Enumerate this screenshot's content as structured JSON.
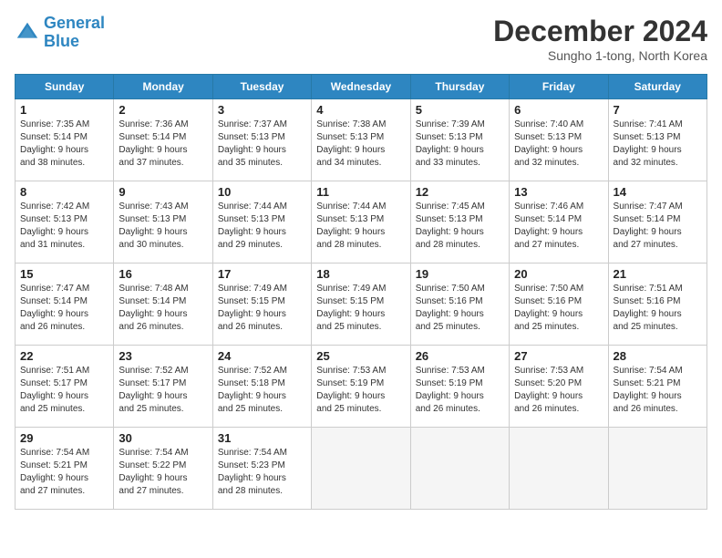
{
  "header": {
    "logo": {
      "line1": "General",
      "line2": "Blue"
    },
    "title": "December 2024",
    "subtitle": "Sungho 1-tong, North Korea"
  },
  "weekdays": [
    "Sunday",
    "Monday",
    "Tuesday",
    "Wednesday",
    "Thursday",
    "Friday",
    "Saturday"
  ],
  "weeks": [
    [
      {
        "day": 1,
        "info": "Sunrise: 7:35 AM\nSunset: 5:14 PM\nDaylight: 9 hours\nand 38 minutes."
      },
      {
        "day": 2,
        "info": "Sunrise: 7:36 AM\nSunset: 5:14 PM\nDaylight: 9 hours\nand 37 minutes."
      },
      {
        "day": 3,
        "info": "Sunrise: 7:37 AM\nSunset: 5:13 PM\nDaylight: 9 hours\nand 35 minutes."
      },
      {
        "day": 4,
        "info": "Sunrise: 7:38 AM\nSunset: 5:13 PM\nDaylight: 9 hours\nand 34 minutes."
      },
      {
        "day": 5,
        "info": "Sunrise: 7:39 AM\nSunset: 5:13 PM\nDaylight: 9 hours\nand 33 minutes."
      },
      {
        "day": 6,
        "info": "Sunrise: 7:40 AM\nSunset: 5:13 PM\nDaylight: 9 hours\nand 32 minutes."
      },
      {
        "day": 7,
        "info": "Sunrise: 7:41 AM\nSunset: 5:13 PM\nDaylight: 9 hours\nand 32 minutes."
      }
    ],
    [
      {
        "day": 8,
        "info": "Sunrise: 7:42 AM\nSunset: 5:13 PM\nDaylight: 9 hours\nand 31 minutes."
      },
      {
        "day": 9,
        "info": "Sunrise: 7:43 AM\nSunset: 5:13 PM\nDaylight: 9 hours\nand 30 minutes."
      },
      {
        "day": 10,
        "info": "Sunrise: 7:44 AM\nSunset: 5:13 PM\nDaylight: 9 hours\nand 29 minutes."
      },
      {
        "day": 11,
        "info": "Sunrise: 7:44 AM\nSunset: 5:13 PM\nDaylight: 9 hours\nand 28 minutes."
      },
      {
        "day": 12,
        "info": "Sunrise: 7:45 AM\nSunset: 5:13 PM\nDaylight: 9 hours\nand 28 minutes."
      },
      {
        "day": 13,
        "info": "Sunrise: 7:46 AM\nSunset: 5:14 PM\nDaylight: 9 hours\nand 27 minutes."
      },
      {
        "day": 14,
        "info": "Sunrise: 7:47 AM\nSunset: 5:14 PM\nDaylight: 9 hours\nand 27 minutes."
      }
    ],
    [
      {
        "day": 15,
        "info": "Sunrise: 7:47 AM\nSunset: 5:14 PM\nDaylight: 9 hours\nand 26 minutes."
      },
      {
        "day": 16,
        "info": "Sunrise: 7:48 AM\nSunset: 5:14 PM\nDaylight: 9 hours\nand 26 minutes."
      },
      {
        "day": 17,
        "info": "Sunrise: 7:49 AM\nSunset: 5:15 PM\nDaylight: 9 hours\nand 26 minutes."
      },
      {
        "day": 18,
        "info": "Sunrise: 7:49 AM\nSunset: 5:15 PM\nDaylight: 9 hours\nand 25 minutes."
      },
      {
        "day": 19,
        "info": "Sunrise: 7:50 AM\nSunset: 5:16 PM\nDaylight: 9 hours\nand 25 minutes."
      },
      {
        "day": 20,
        "info": "Sunrise: 7:50 AM\nSunset: 5:16 PM\nDaylight: 9 hours\nand 25 minutes."
      },
      {
        "day": 21,
        "info": "Sunrise: 7:51 AM\nSunset: 5:16 PM\nDaylight: 9 hours\nand 25 minutes."
      }
    ],
    [
      {
        "day": 22,
        "info": "Sunrise: 7:51 AM\nSunset: 5:17 PM\nDaylight: 9 hours\nand 25 minutes."
      },
      {
        "day": 23,
        "info": "Sunrise: 7:52 AM\nSunset: 5:17 PM\nDaylight: 9 hours\nand 25 minutes."
      },
      {
        "day": 24,
        "info": "Sunrise: 7:52 AM\nSunset: 5:18 PM\nDaylight: 9 hours\nand 25 minutes."
      },
      {
        "day": 25,
        "info": "Sunrise: 7:53 AM\nSunset: 5:19 PM\nDaylight: 9 hours\nand 25 minutes."
      },
      {
        "day": 26,
        "info": "Sunrise: 7:53 AM\nSunset: 5:19 PM\nDaylight: 9 hours\nand 26 minutes."
      },
      {
        "day": 27,
        "info": "Sunrise: 7:53 AM\nSunset: 5:20 PM\nDaylight: 9 hours\nand 26 minutes."
      },
      {
        "day": 28,
        "info": "Sunrise: 7:54 AM\nSunset: 5:21 PM\nDaylight: 9 hours\nand 26 minutes."
      }
    ],
    [
      {
        "day": 29,
        "info": "Sunrise: 7:54 AM\nSunset: 5:21 PM\nDaylight: 9 hours\nand 27 minutes."
      },
      {
        "day": 30,
        "info": "Sunrise: 7:54 AM\nSunset: 5:22 PM\nDaylight: 9 hours\nand 27 minutes."
      },
      {
        "day": 31,
        "info": "Sunrise: 7:54 AM\nSunset: 5:23 PM\nDaylight: 9 hours\nand 28 minutes."
      },
      null,
      null,
      null,
      null
    ]
  ]
}
